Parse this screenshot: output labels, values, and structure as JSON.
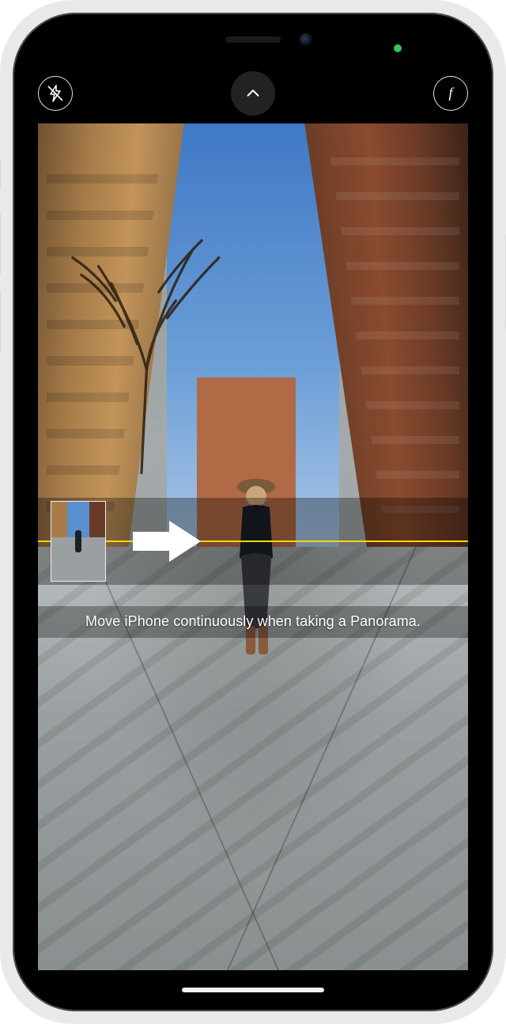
{
  "status": {
    "camera_indicator_color": "#34c759"
  },
  "controls": {
    "flash_icon": "flash-off-icon",
    "expand_icon": "chevron-up-icon",
    "effects_icon": "aperture-f-icon"
  },
  "panorama": {
    "instruction_text": "Move iPhone continuously when taking a Panorama.",
    "guide_line_color": "#ffd60a",
    "arrow_direction": "right"
  },
  "mode": "PANO"
}
